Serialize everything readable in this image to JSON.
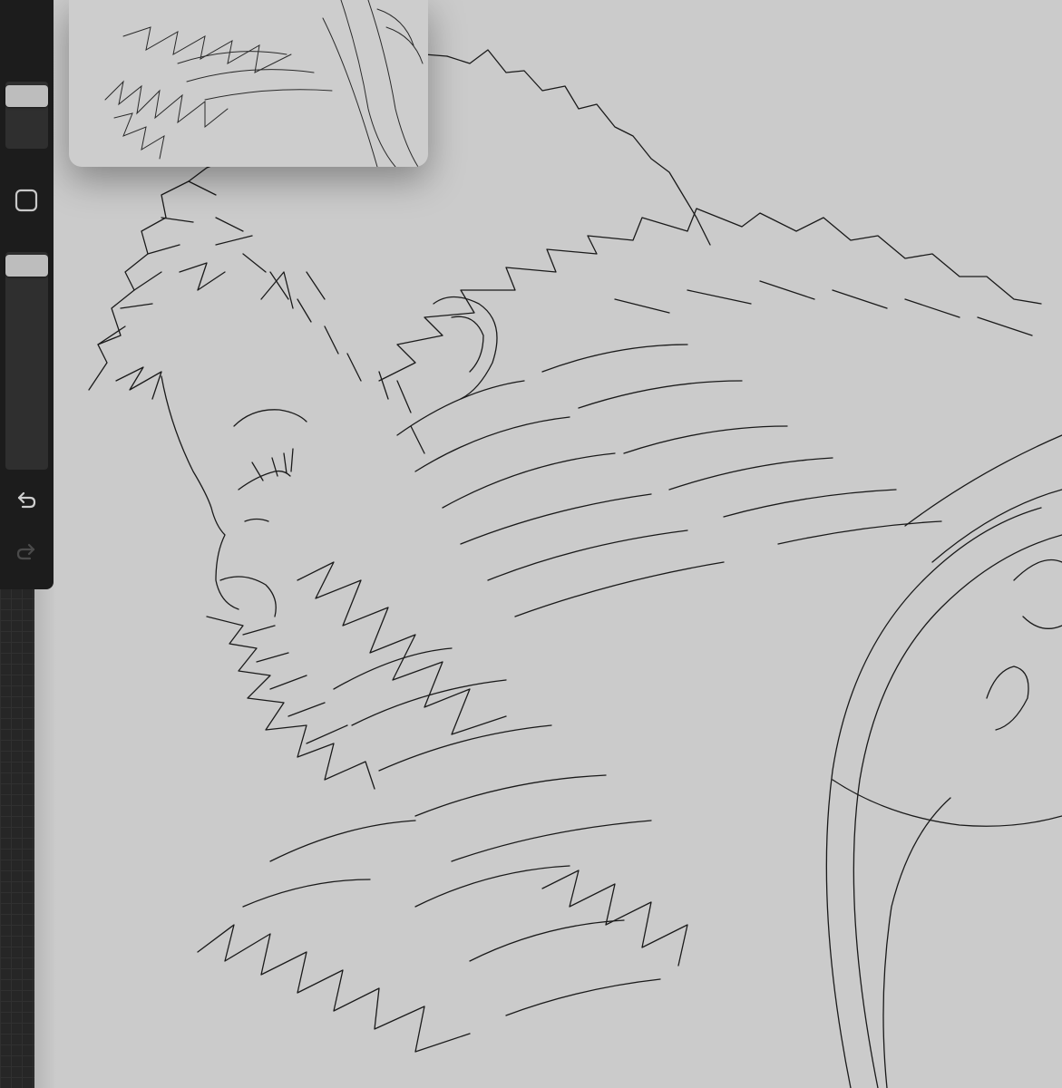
{
  "app": {
    "accent": "#bdbdbd",
    "canvas_color": "#cbcbcb",
    "sidebar_color": "#1c1c1c"
  },
  "sidebar": {
    "brush_size": {
      "icon": "brush-size-slider",
      "level": 0.95
    },
    "modify_button": {
      "icon": "square-icon"
    },
    "brush_opacity": {
      "icon": "brush-opacity-slider",
      "level": 0.98
    },
    "undo": {
      "icon": "undo-arrow-icon",
      "enabled": true
    },
    "redo": {
      "icon": "redo-arrow-icon",
      "enabled": false
    }
  },
  "reference_window": {
    "icon": "reference-preview"
  },
  "artwork": {
    "icon": "line-drawing-bearded-man-fur-coat"
  }
}
